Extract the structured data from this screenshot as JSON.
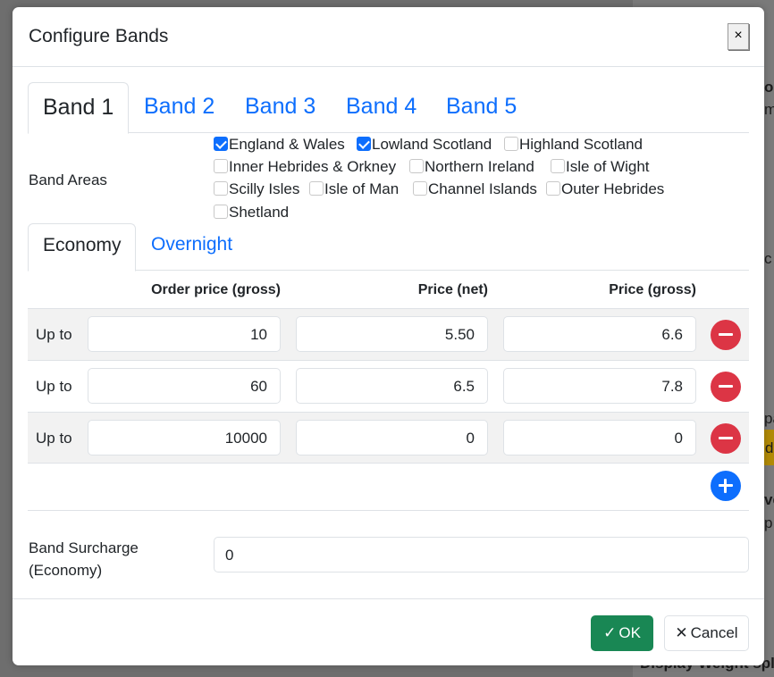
{
  "background": {
    "fragments": [
      "o",
      "m",
      "c",
      "pa",
      "d",
      "ve",
      "p",
      "Display Weight spl"
    ]
  },
  "modal": {
    "title": "Configure Bands",
    "close_label": "×"
  },
  "band_tabs": [
    "Band 1",
    "Band 2",
    "Band 3",
    "Band 4",
    "Band 5"
  ],
  "band_areas": {
    "label": "Band Areas",
    "items": [
      {
        "label": "England & Wales",
        "checked": true
      },
      {
        "label": "Lowland Scotland",
        "checked": true
      },
      {
        "label": "Highland Scotland",
        "checked": false
      },
      {
        "label": "Inner Hebrides & Orkney",
        "checked": false
      },
      {
        "label": "Northern Ireland",
        "checked": false
      },
      {
        "label": "Isle of Wight",
        "checked": false
      },
      {
        "label": "Scilly Isles",
        "checked": false
      },
      {
        "label": "Isle of Man",
        "checked": false
      },
      {
        "label": "Channel Islands",
        "checked": false
      },
      {
        "label": "Outer Hebrides",
        "checked": false
      },
      {
        "label": "Shetland",
        "checked": false
      }
    ]
  },
  "service_tabs": [
    "Economy",
    "Overnight"
  ],
  "table": {
    "headers": [
      "Order price (gross)",
      "Price (net)",
      "Price (gross)"
    ],
    "rows": [
      {
        "prefix": "Up to",
        "order_price": "10",
        "price_net": "5.50",
        "price_gross": "6.6"
      },
      {
        "prefix": "Up to",
        "order_price": "60",
        "price_net": "6.5",
        "price_gross": "7.8"
      },
      {
        "prefix": "Up to",
        "order_price": "10000",
        "price_net": "0",
        "price_gross": "0"
      }
    ]
  },
  "surcharge": {
    "label_line1": "Band Surcharge",
    "label_line2": "(Economy)",
    "value": "0"
  },
  "footer": {
    "ok_label": "OK",
    "cancel_label": "Cancel"
  },
  "colors": {
    "primary": "#0d6efd",
    "danger": "#dc3545",
    "success": "#198754"
  }
}
